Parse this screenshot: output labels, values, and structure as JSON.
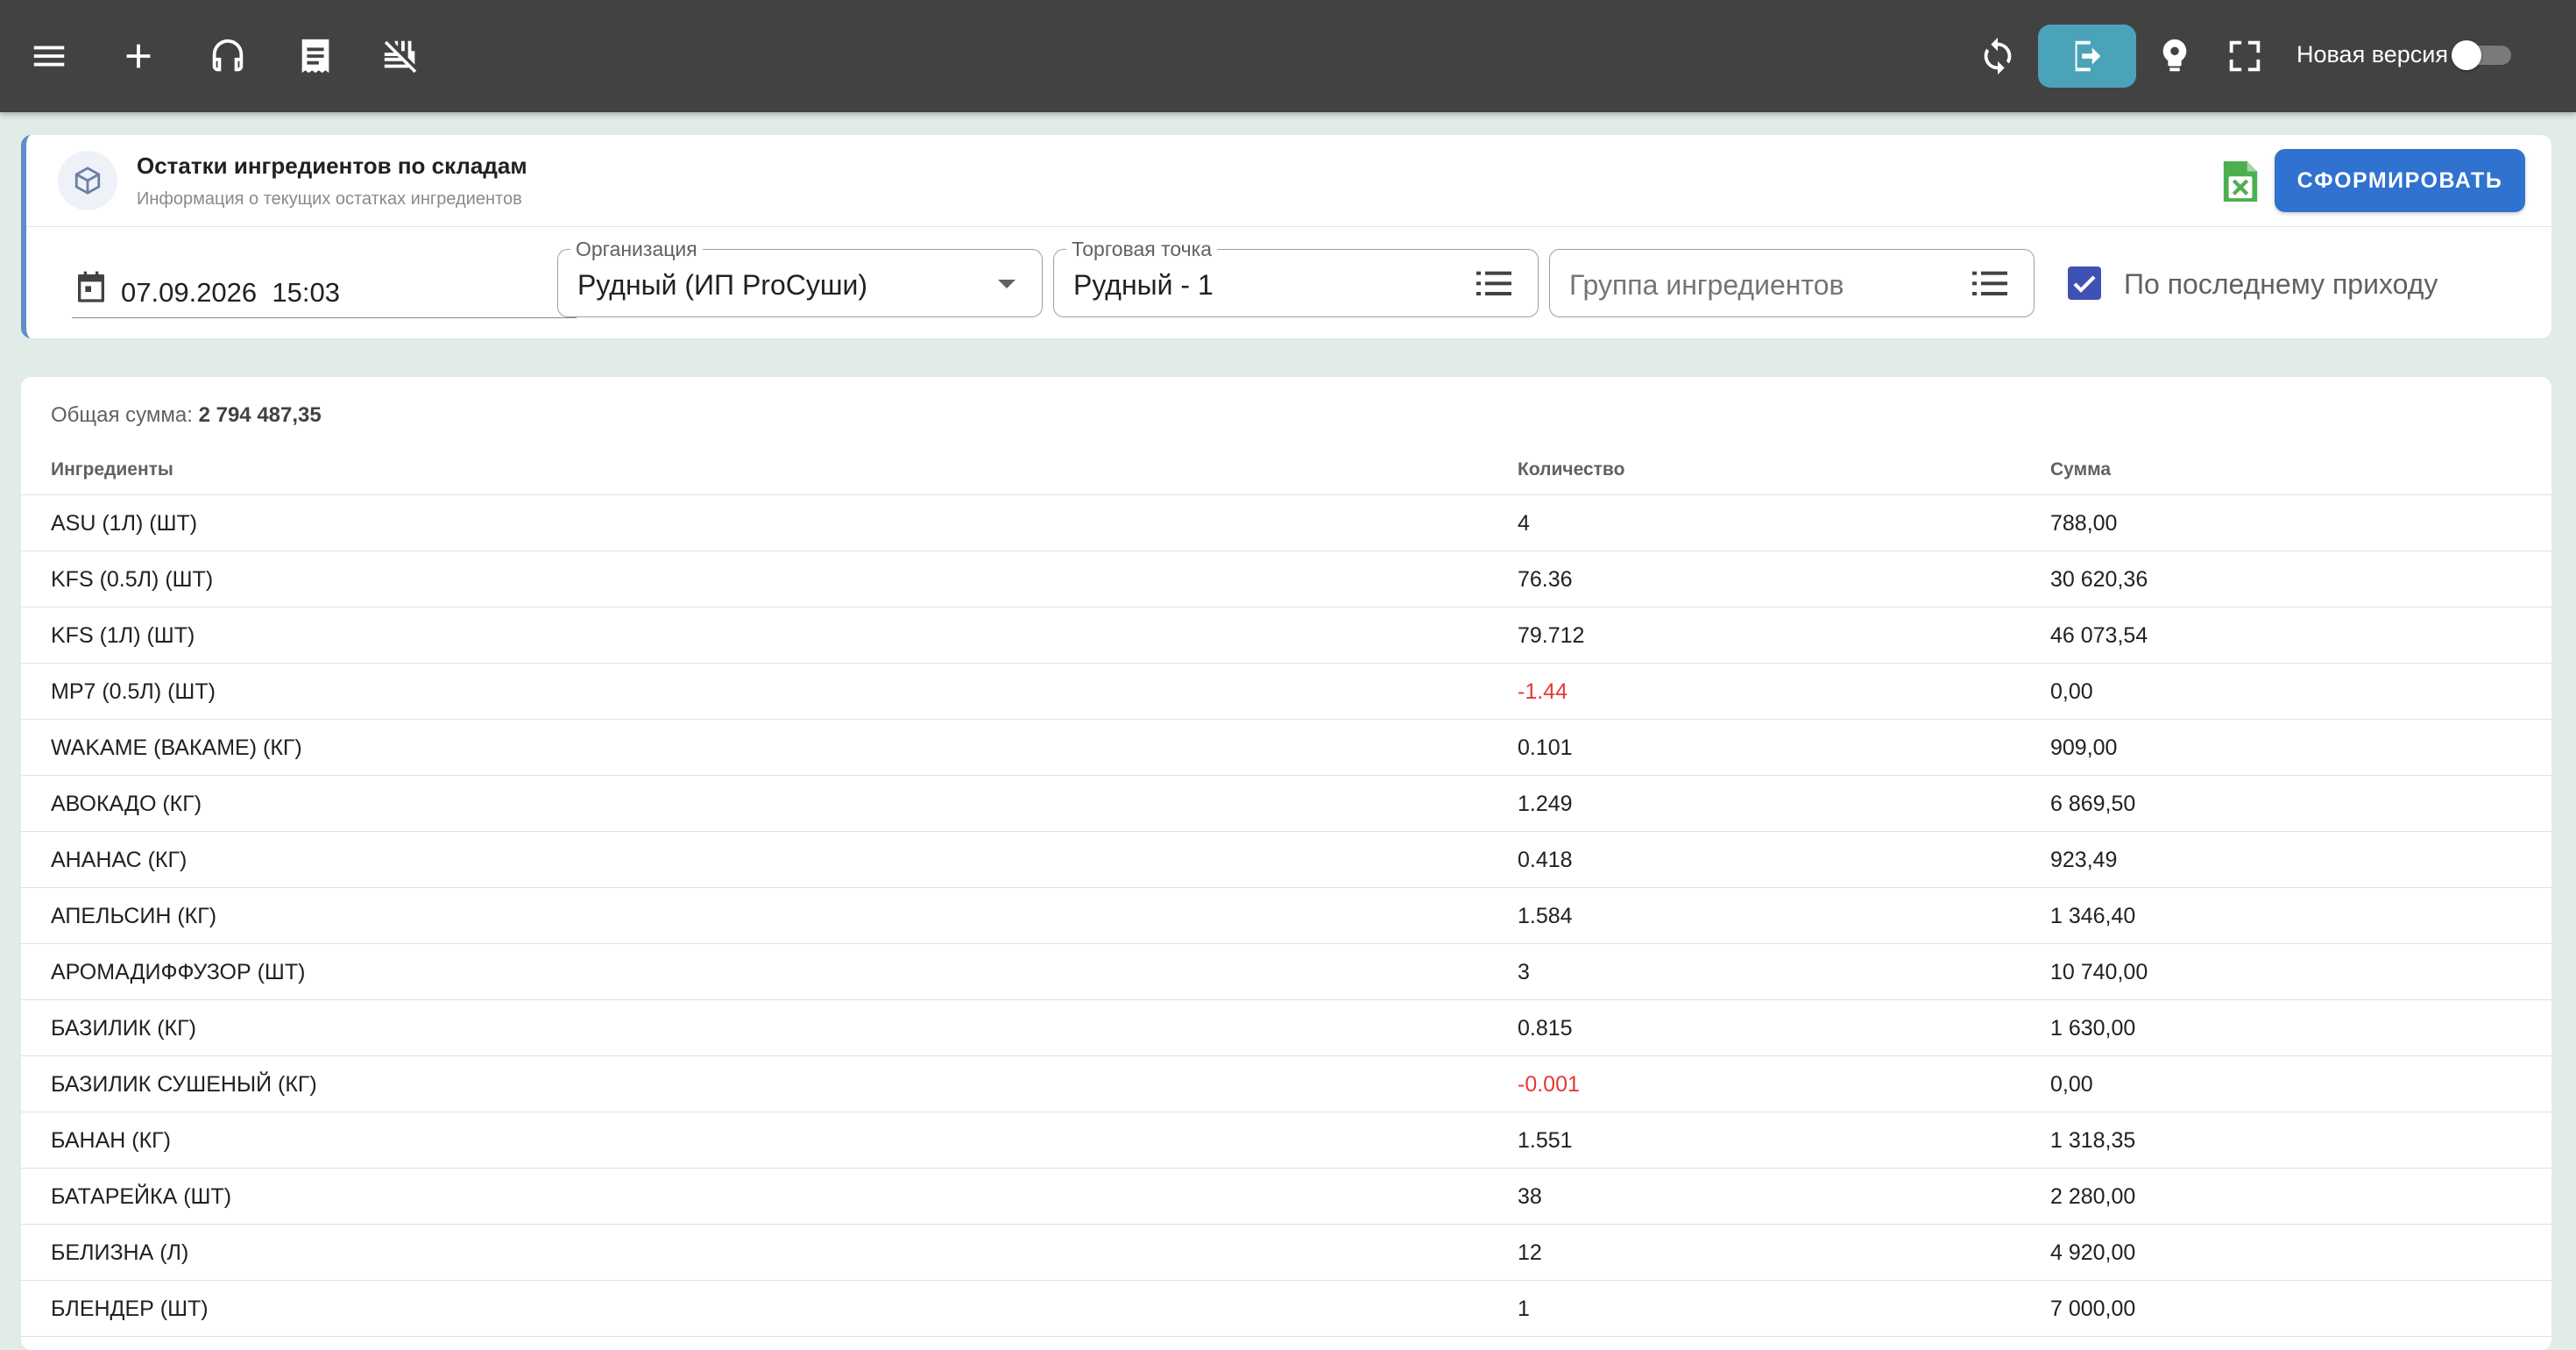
{
  "topbar": {
    "icons": [
      "menu-icon",
      "plus-icon",
      "headset-icon",
      "receipt-icon",
      "food-off-icon",
      "sync-icon",
      "logout-icon",
      "settings-bulb-icon",
      "fullscreen-icon"
    ],
    "new_version_label": "Новая версия",
    "new_version_enabled": false
  },
  "report": {
    "title": "Остатки ингредиентов по складам",
    "subtitle": "Информация о текущих остатках ингредиентов",
    "generate_label": "СФОРМИРОВАТЬ",
    "excel_icon": "excel-icon",
    "accent": "#2f72cf"
  },
  "filters": {
    "date_value": "07.09.2026  15:03",
    "organization_label": "Организация",
    "organization_value": "Рудный (ИП ProСуши)",
    "outlet_label": "Торговая точка",
    "outlet_value": "Рудный - 1",
    "group_placeholder": "Группа ингредиентов",
    "last_receipt_label": "По последнему приходу",
    "last_receipt_checked": true
  },
  "table": {
    "total_label": "Общая сумма: ",
    "total_value": "2 794 487,35",
    "columns": [
      "Ингредиенты",
      "Количество",
      "Сумма"
    ],
    "rows": [
      {
        "name": "ASU (1Л) (ШТ)",
        "qty": "4",
        "sum": "788,00"
      },
      {
        "name": "KFS (0.5Л) (ШТ)",
        "qty": "76.36",
        "sum": "30 620,36"
      },
      {
        "name": "KFS (1Л) (ШТ)",
        "qty": "79.712",
        "sum": "46 073,54"
      },
      {
        "name": "MP7 (0.5Л) (ШТ)",
        "qty": "-1.44",
        "sum": "0,00"
      },
      {
        "name": "WAKAME (ВАКАМЕ) (КГ)",
        "qty": "0.101",
        "sum": "909,00"
      },
      {
        "name": "АВОКАДО (КГ)",
        "qty": "1.249",
        "sum": "6 869,50"
      },
      {
        "name": "АНАНАС (КГ)",
        "qty": "0.418",
        "sum": "923,49"
      },
      {
        "name": "АПЕЛЬСИН (КГ)",
        "qty": "1.584",
        "sum": "1 346,40"
      },
      {
        "name": "АРОМАДИФФУЗОР (ШТ)",
        "qty": "3",
        "sum": "10 740,00"
      },
      {
        "name": "БАЗИЛИК (КГ)",
        "qty": "0.815",
        "sum": "1 630,00"
      },
      {
        "name": "БАЗИЛИК СУШЕНЫЙ (КГ)",
        "qty": "-0.001",
        "sum": "0,00"
      },
      {
        "name": "БАНАН (КГ)",
        "qty": "1.551",
        "sum": "1 318,35"
      },
      {
        "name": "БАТАРЕЙКА (ШТ)",
        "qty": "38",
        "sum": "2 280,00"
      },
      {
        "name": "БЕЛИЗНА (Л)",
        "qty": "12",
        "sum": "4 920,00"
      },
      {
        "name": "БЛЕНДЕР (ШТ)",
        "qty": "1",
        "sum": "7 000,00"
      }
    ],
    "negative_color": "#e53935"
  }
}
